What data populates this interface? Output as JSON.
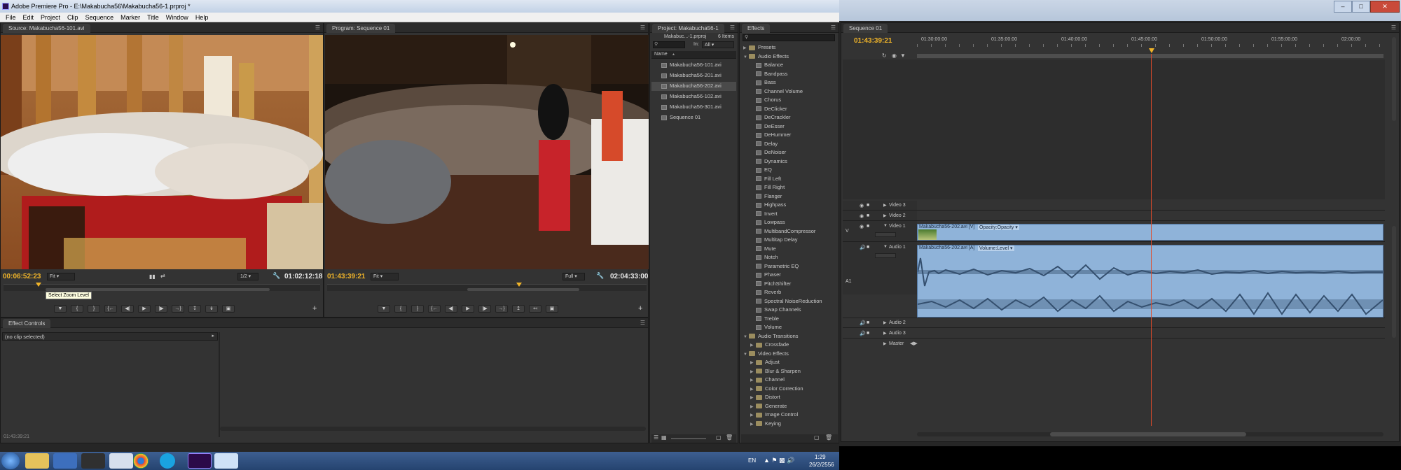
{
  "window": {
    "title": "Adobe Premiere Pro - E:\\Makabucha56\\Makabucha56-1.prproj *"
  },
  "menu": [
    "File",
    "Edit",
    "Project",
    "Clip",
    "Sequence",
    "Marker",
    "Title",
    "Window",
    "Help"
  ],
  "source_monitor": {
    "tab": "Source: Makabucha56-101.avi",
    "timecode_current": "00:06:52:23",
    "timecode_duration": "01:02:12:18",
    "fit": "Fit",
    "resolution": "1/2",
    "tooltip": "Select Zoom Level"
  },
  "program_monitor": {
    "tab": "Program: Sequence 01",
    "timecode_current": "01:43:39:21",
    "timecode_duration": "02:04:33:00",
    "fit": "Fit",
    "resolution": "Full"
  },
  "effect_controls": {
    "tab": "Effect Controls",
    "no_clip": "(no clip selected)",
    "timecode": "01:43:39:21"
  },
  "project": {
    "tab": "Project: Makabucha56-1",
    "file": "Makabuc...-1.prproj",
    "count": "6 Items",
    "in_label": "In:",
    "in_value": "All",
    "col_name": "Name",
    "items": [
      {
        "name": "Makabucha56-101.avi",
        "selected": false
      },
      {
        "name": "Makabucha56-201.avi",
        "selected": false
      },
      {
        "name": "Makabucha56-202.avi",
        "selected": true
      },
      {
        "name": "Makabucha56-102.avi",
        "selected": false
      },
      {
        "name": "Makabucha56-301.avi",
        "selected": false
      },
      {
        "name": "Sequence 01",
        "selected": false
      }
    ]
  },
  "effects": {
    "tab": "Effects",
    "rows": [
      {
        "label": "Presets",
        "kind": "folder",
        "open": false,
        "indent": 0
      },
      {
        "label": "Audio Effects",
        "kind": "folder",
        "open": true,
        "indent": 0
      },
      {
        "label": "Balance",
        "kind": "fx",
        "indent": 1
      },
      {
        "label": "Bandpass",
        "kind": "fx",
        "indent": 1
      },
      {
        "label": "Bass",
        "kind": "fx",
        "indent": 1
      },
      {
        "label": "Channel Volume",
        "kind": "fx",
        "indent": 1
      },
      {
        "label": "Chorus",
        "kind": "fx",
        "indent": 1
      },
      {
        "label": "DeClicker",
        "kind": "fx",
        "indent": 1
      },
      {
        "label": "DeCrackler",
        "kind": "fx",
        "indent": 1
      },
      {
        "label": "DeEsser",
        "kind": "fx",
        "indent": 1
      },
      {
        "label": "DeHummer",
        "kind": "fx",
        "indent": 1
      },
      {
        "label": "Delay",
        "kind": "fx",
        "indent": 1
      },
      {
        "label": "DeNoiser",
        "kind": "fx",
        "indent": 1
      },
      {
        "label": "Dynamics",
        "kind": "fx",
        "indent": 1
      },
      {
        "label": "EQ",
        "kind": "fx",
        "indent": 1
      },
      {
        "label": "Fill Left",
        "kind": "fx",
        "indent": 1
      },
      {
        "label": "Fill Right",
        "kind": "fx",
        "indent": 1
      },
      {
        "label": "Flanger",
        "kind": "fx",
        "indent": 1
      },
      {
        "label": "Highpass",
        "kind": "fx",
        "indent": 1
      },
      {
        "label": "Invert",
        "kind": "fx",
        "indent": 1
      },
      {
        "label": "Lowpass",
        "kind": "fx",
        "indent": 1
      },
      {
        "label": "MultibandCompressor",
        "kind": "fx",
        "indent": 1
      },
      {
        "label": "Multitap Delay",
        "kind": "fx",
        "indent": 1
      },
      {
        "label": "Mute",
        "kind": "fx",
        "indent": 1
      },
      {
        "label": "Notch",
        "kind": "fx",
        "indent": 1
      },
      {
        "label": "Parametric EQ",
        "kind": "fx",
        "indent": 1
      },
      {
        "label": "Phaser",
        "kind": "fx",
        "indent": 1
      },
      {
        "label": "PitchShifter",
        "kind": "fx",
        "indent": 1
      },
      {
        "label": "Reverb",
        "kind": "fx",
        "indent": 1
      },
      {
        "label": "Spectral NoiseReduction",
        "kind": "fx",
        "indent": 1
      },
      {
        "label": "Swap Channels",
        "kind": "fx",
        "indent": 1
      },
      {
        "label": "Treble",
        "kind": "fx",
        "indent": 1
      },
      {
        "label": "Volume",
        "kind": "fx",
        "indent": 1
      },
      {
        "label": "Audio Transitions",
        "kind": "folder",
        "open": true,
        "indent": 0
      },
      {
        "label": "Crossfade",
        "kind": "folder",
        "open": false,
        "indent": 1
      },
      {
        "label": "Video Effects",
        "kind": "folder",
        "open": true,
        "indent": 0
      },
      {
        "label": "Adjust",
        "kind": "folder",
        "open": false,
        "indent": 1
      },
      {
        "label": "Blur & Sharpen",
        "kind": "folder",
        "open": false,
        "indent": 1
      },
      {
        "label": "Channel",
        "kind": "folder",
        "open": false,
        "indent": 1
      },
      {
        "label": "Color Correction",
        "kind": "folder",
        "open": false,
        "indent": 1
      },
      {
        "label": "Distort",
        "kind": "folder",
        "open": false,
        "indent": 1
      },
      {
        "label": "Generate",
        "kind": "folder",
        "open": false,
        "indent": 1
      },
      {
        "label": "Image Control",
        "kind": "folder",
        "open": false,
        "indent": 1
      },
      {
        "label": "Keying",
        "kind": "folder",
        "open": false,
        "indent": 1
      }
    ]
  },
  "timeline": {
    "tab": "Sequence 01",
    "timecode": "01:43:39:21",
    "ruler": [
      "01:30:00:00",
      "01:35:00:00",
      "01:40:00:00",
      "01:45:00:00",
      "01:50:00:00",
      "01:55:00:00",
      "02:00:00"
    ],
    "tracks": {
      "video3": "Video 3",
      "video2": "Video 2",
      "video1": "Video 1",
      "audio1": "Audio 1",
      "audio2": "Audio 2",
      "audio3": "Audio 3",
      "master": "Master"
    },
    "v_target": "V",
    "a_target": "A1",
    "video_clip": {
      "name": "Makabucha56-202.avi [V]",
      "fx": "Opacity:Opacity ▾"
    },
    "audio_clip": {
      "name": "Makabucha56-202.avi [A]",
      "fx": "Volume:Level ▾"
    }
  },
  "taskbar": {
    "lang": "EN",
    "time": "1:29",
    "date": "26/2/2556",
    "apps": [
      "windows-explorer",
      "files-folder",
      "media",
      "camera",
      "word",
      "chrome",
      "skype",
      "premiere",
      "paint"
    ]
  }
}
